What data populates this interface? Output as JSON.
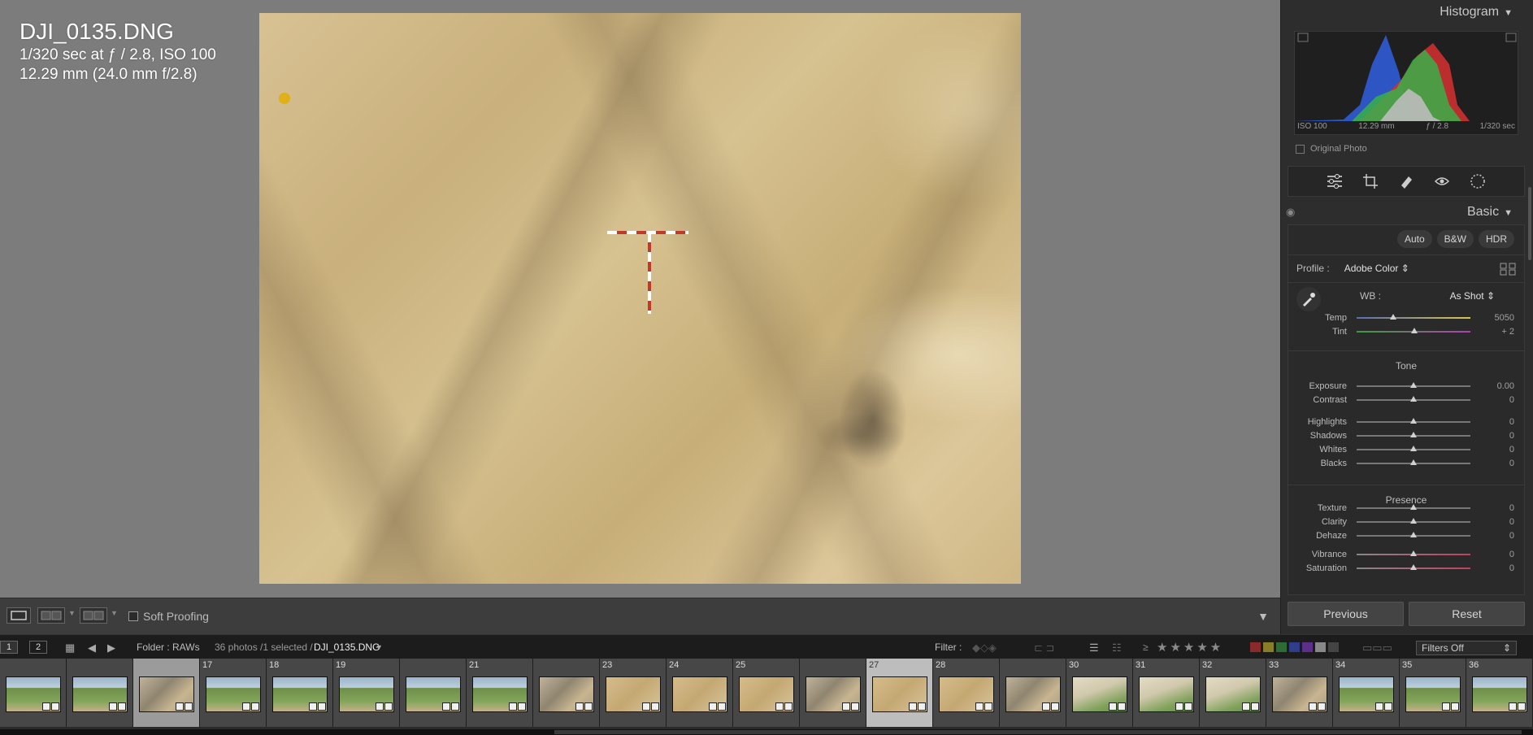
{
  "photo_info": {
    "filename": "DJI_0135.DNG",
    "exposure": "1/320 sec at ƒ / 2.8, ISO 100",
    "lens": "12.29 mm (24.0 mm f/2.8)"
  },
  "toolbar": {
    "soft_proofing": "Soft Proofing"
  },
  "panel": {
    "histogram_title": "Histogram",
    "hist_iso": "ISO 100",
    "hist_focal": "12.29 mm",
    "hist_aperture": "ƒ / 2.8",
    "hist_shutter": "1/320 sec",
    "original_photo": "Original Photo",
    "basic_title": "Basic",
    "buttons": {
      "auto": "Auto",
      "bw": "B&W",
      "hdr": "HDR"
    },
    "profile_label": "Profile :",
    "profile_value": "Adobe Color",
    "wb_label": "WB :",
    "wb_value": "As Shot",
    "tone_label": "Tone",
    "presence_label": "Presence",
    "sliders": [
      {
        "label": "Temp",
        "value": "5050",
        "pos": 0.32
      },
      {
        "label": "Tint",
        "value": "+ 2",
        "pos": 0.51
      },
      {
        "label": "Exposure",
        "value": "0.00",
        "pos": 0.5
      },
      {
        "label": "Contrast",
        "value": "0",
        "pos": 0.5
      },
      {
        "label": "Highlights",
        "value": "0",
        "pos": 0.5
      },
      {
        "label": "Shadows",
        "value": "0",
        "pos": 0.5
      },
      {
        "label": "Whites",
        "value": "0",
        "pos": 0.5
      },
      {
        "label": "Blacks",
        "value": "0",
        "pos": 0.5
      },
      {
        "label": "Texture",
        "value": "0",
        "pos": 0.5
      },
      {
        "label": "Clarity",
        "value": "0",
        "pos": 0.5
      },
      {
        "label": "Dehaze",
        "value": "0",
        "pos": 0.5
      },
      {
        "label": "Vibrance",
        "value": "0",
        "pos": 0.5
      },
      {
        "label": "Saturation",
        "value": "0",
        "pos": 0.5
      }
    ],
    "previous": "Previous",
    "reset": "Reset"
  },
  "filmbar": {
    "view1": "1",
    "view2": "2",
    "folder": "Folder : RAWs",
    "count": "36 photos /1 selected /",
    "selected_file": "DJI_0135.DNG",
    "filter_label": "Filter :",
    "filter_value": "Filters Off",
    "stars_prefix": "≥"
  },
  "filmstrip": [
    {
      "n": "",
      "t": "green"
    },
    {
      "n": "",
      "t": "green"
    },
    {
      "n": "",
      "t": "site"
    },
    {
      "n": "17",
      "t": "green"
    },
    {
      "n": "18",
      "t": "green"
    },
    {
      "n": "19",
      "t": "green"
    },
    {
      "n": "",
      "t": "green"
    },
    {
      "n": "21",
      "t": "green"
    },
    {
      "n": "",
      "t": "site"
    },
    {
      "n": "23",
      "t": "soil"
    },
    {
      "n": "24",
      "t": "soil"
    },
    {
      "n": "25",
      "t": "soil"
    },
    {
      "n": "",
      "t": "site"
    },
    {
      "n": "27",
      "t": "soil"
    },
    {
      "n": "28",
      "t": "soil"
    },
    {
      "n": "",
      "t": "site"
    },
    {
      "n": "30",
      "t": "field"
    },
    {
      "n": "31",
      "t": "field"
    },
    {
      "n": "32",
      "t": "field"
    },
    {
      "n": "33",
      "t": "site"
    },
    {
      "n": "34",
      "t": "green"
    },
    {
      "n": "35",
      "t": "green"
    },
    {
      "n": "36",
      "t": "green"
    }
  ]
}
